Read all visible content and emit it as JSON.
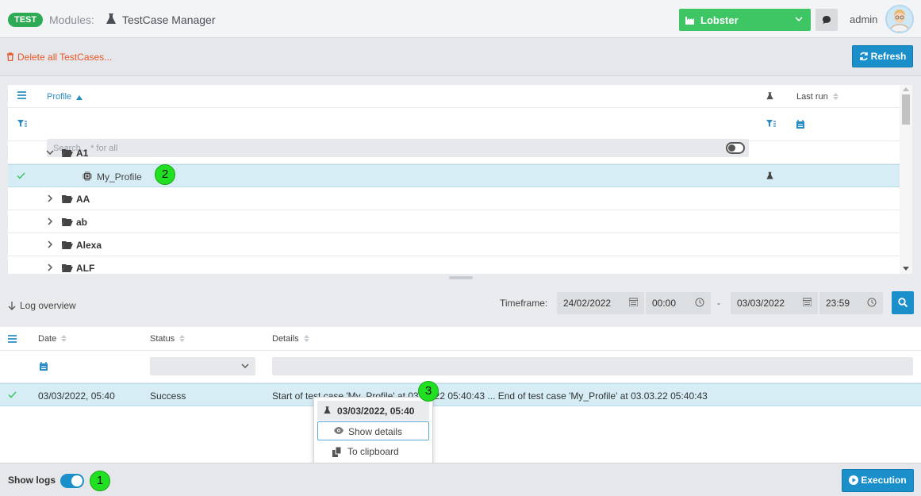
{
  "header": {
    "env_badge": "TEST",
    "modules_label": "Modules:",
    "module_name": "TestCase Manager",
    "project": "Lobster",
    "user": "admin"
  },
  "toolbar": {
    "delete_all": "Delete all TestCases...",
    "refresh": "Refresh"
  },
  "tree": {
    "col_profile": "Profile",
    "col_last_run": "Last run",
    "search_placeholder": "Search... * for all",
    "rows": [
      {
        "label": "A1",
        "type": "folder",
        "expanded": true
      },
      {
        "label": "My_Profile",
        "type": "profile",
        "selected": true
      },
      {
        "label": "AA",
        "type": "folder",
        "expanded": false
      },
      {
        "label": "ab",
        "type": "folder",
        "expanded": false
      },
      {
        "label": "Alexa",
        "type": "folder",
        "expanded": false
      },
      {
        "label": "ALF",
        "type": "folder",
        "expanded": false
      }
    ]
  },
  "log": {
    "title": "Log overview",
    "timeframe_label": "Timeframe:",
    "from_date": "24/02/2022",
    "from_time": "00:00",
    "dash": "-",
    "to_date": "03/03/2022",
    "to_time": "23:59",
    "col_date": "Date",
    "col_status": "Status",
    "col_details": "Details",
    "entry": {
      "date": "03/03/2022, 05:40",
      "status": "Success",
      "details": "Start of test case 'My_Profile' at 03.03.22 05:40:43 ... End of test case 'My_Profile' at 03.03.22 05:40:43"
    }
  },
  "context_menu": {
    "title": "03/03/2022, 05:40",
    "show_details": "Show details",
    "to_clipboard": "To clipboard"
  },
  "footer": {
    "show_logs": "Show logs",
    "execution": "Execution"
  },
  "callouts": [
    "1",
    "2",
    "3"
  ],
  "colors": {
    "accent": "#1a8fc9",
    "env_badge": "#2eaa55",
    "project": "#3ec564",
    "danger": "#e8562b",
    "selected_row": "#d6edf5",
    "callout": "#21e021"
  }
}
